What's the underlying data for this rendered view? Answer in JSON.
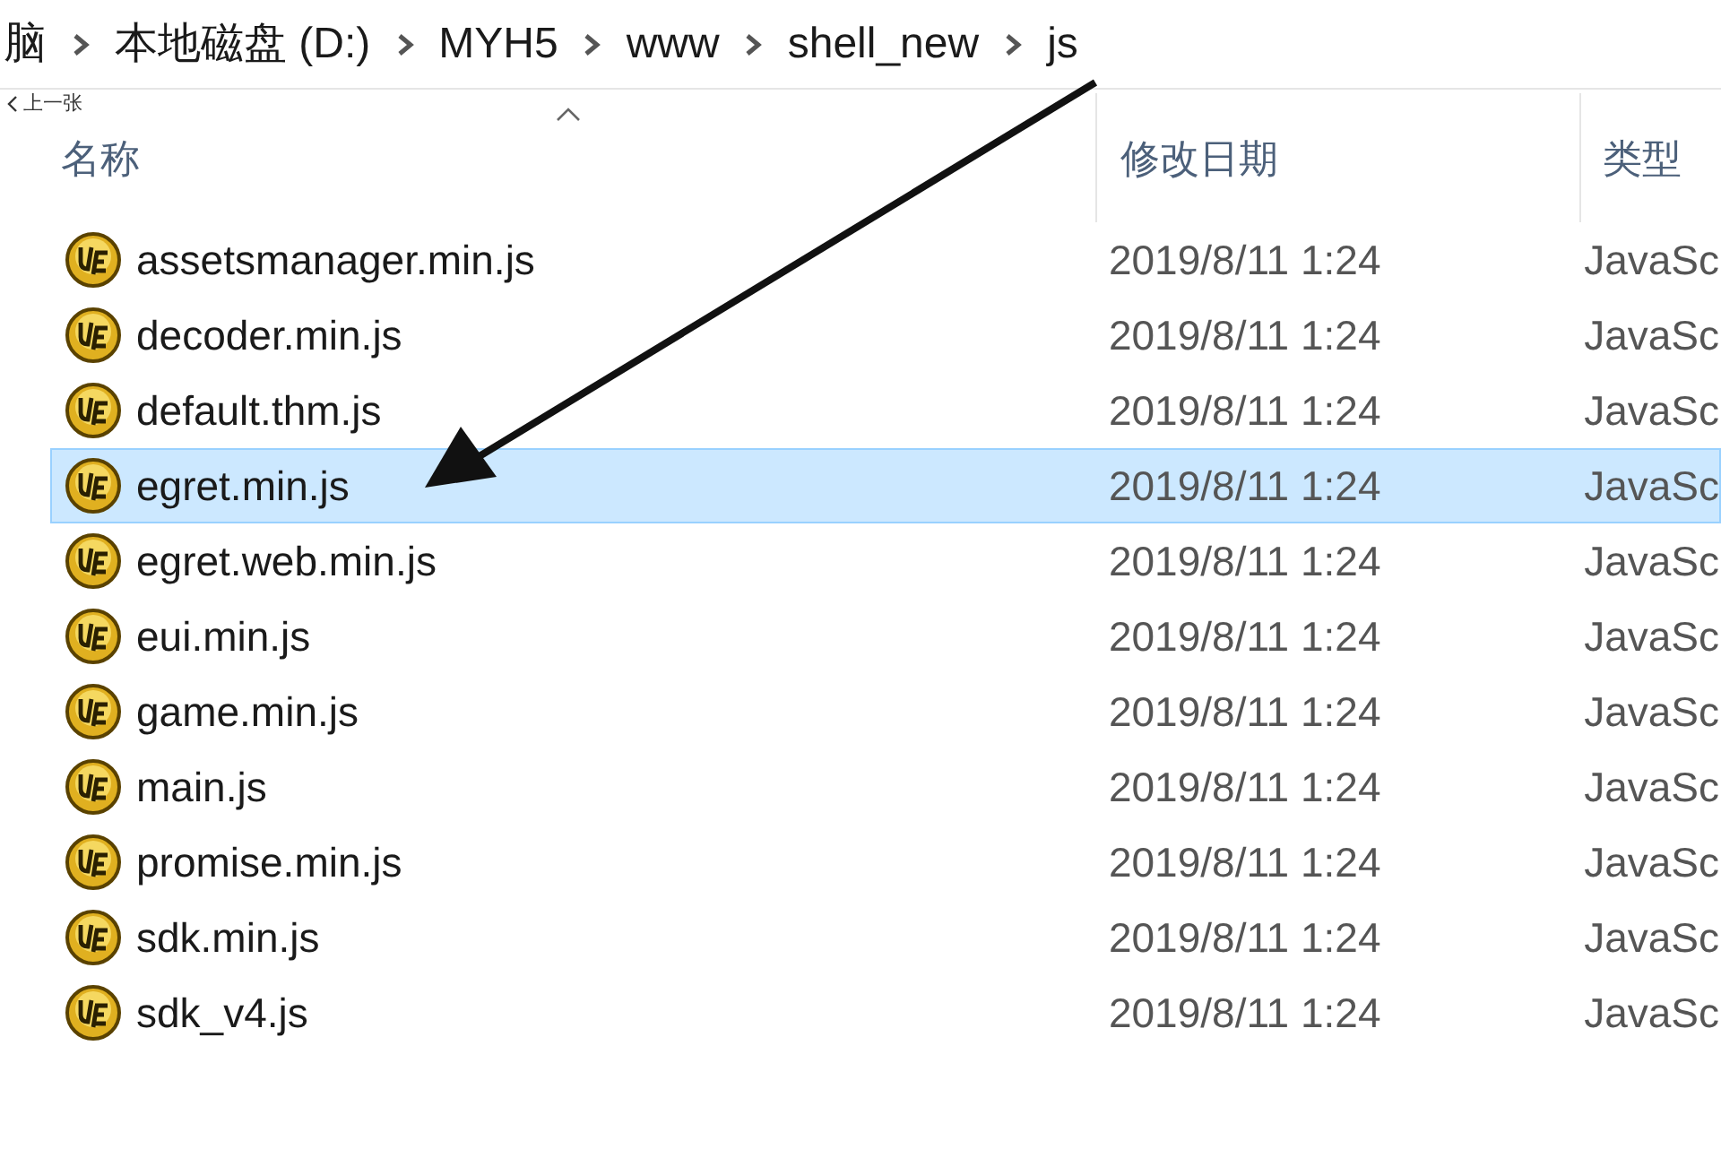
{
  "breadcrumb": [
    "脑",
    "本地磁盘 (D:)",
    "MYH5",
    "www",
    "shell_new",
    "js"
  ],
  "prev_button": {
    "label": "上一张"
  },
  "columns": [
    {
      "label": "名称",
      "sorted": true
    },
    {
      "label": "修改日期",
      "sorted": false
    },
    {
      "label": "类型",
      "sorted": false
    }
  ],
  "rows": [
    {
      "name": "assetsmanager.min.js",
      "date": "2019/8/11 1:24",
      "type": "JavaSc",
      "selected": false
    },
    {
      "name": "decoder.min.js",
      "date": "2019/8/11 1:24",
      "type": "JavaSc",
      "selected": false
    },
    {
      "name": "default.thm.js",
      "date": "2019/8/11 1:24",
      "type": "JavaSc",
      "selected": false
    },
    {
      "name": "egret.min.js",
      "date": "2019/8/11 1:24",
      "type": "JavaSc",
      "selected": true
    },
    {
      "name": "egret.web.min.js",
      "date": "2019/8/11 1:24",
      "type": "JavaSc",
      "selected": false
    },
    {
      "name": "eui.min.js",
      "date": "2019/8/11 1:24",
      "type": "JavaSc",
      "selected": false
    },
    {
      "name": "game.min.js",
      "date": "2019/8/11 1:24",
      "type": "JavaSc",
      "selected": false
    },
    {
      "name": "main.js",
      "date": "2019/8/11 1:24",
      "type": "JavaSc",
      "selected": false
    },
    {
      "name": "promise.min.js",
      "date": "2019/8/11 1:24",
      "type": "JavaSc",
      "selected": false
    },
    {
      "name": "sdk.min.js",
      "date": "2019/8/11 1:24",
      "type": "JavaSc",
      "selected": false
    },
    {
      "name": "sdk_v4.js",
      "date": "2019/8/11 1:24",
      "type": "JavaSc",
      "selected": false
    }
  ]
}
